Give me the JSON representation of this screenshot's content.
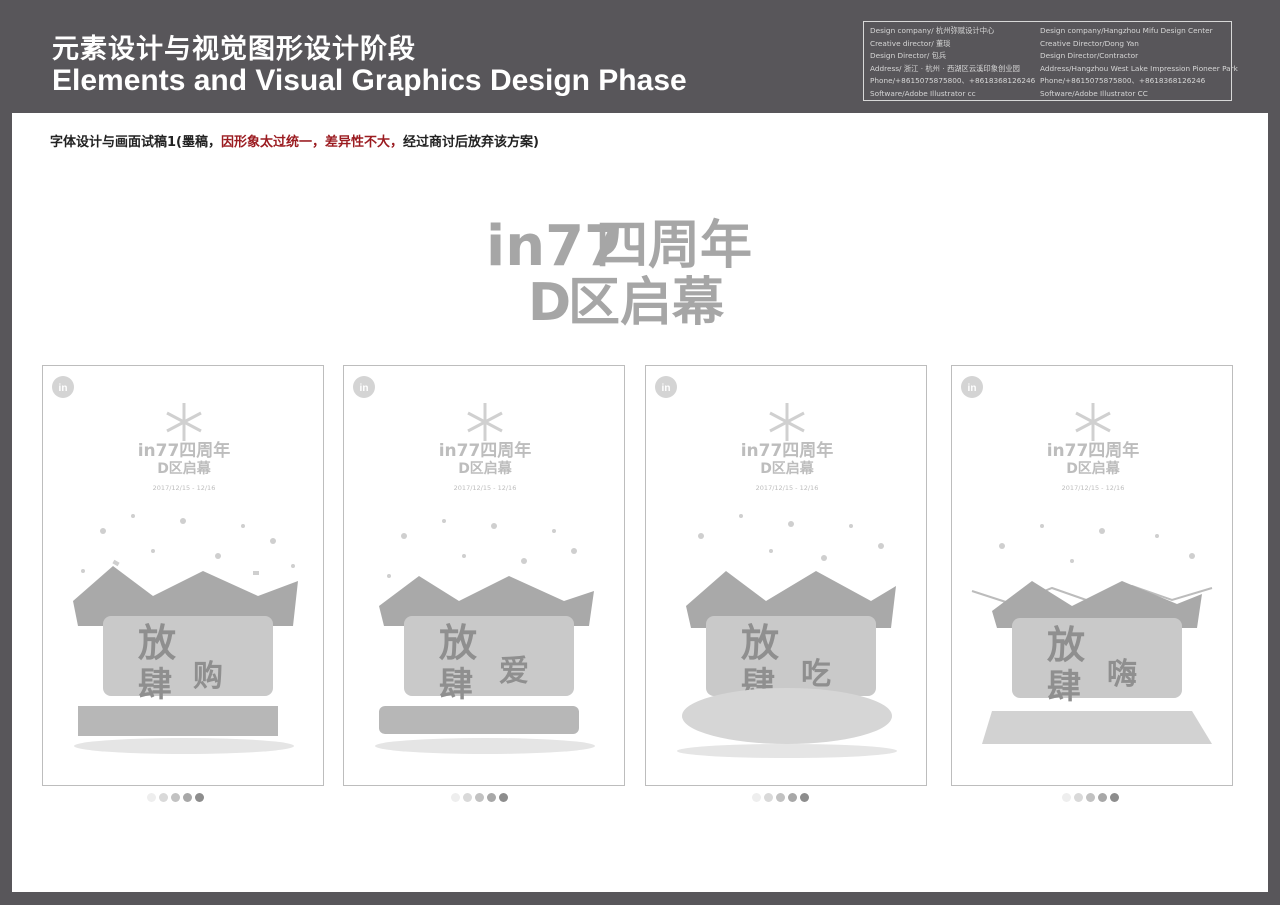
{
  "header": {
    "title_cn": "元素设计与视觉图形设计阶段",
    "title_en": "Elements and Visual Graphics Design Phase"
  },
  "info": {
    "left": [
      "Design company/ 杭州弥赋设计中心",
      "Creative director/ 董琰",
      "Design Director/ 包兵",
      "Address/ 浙江 · 杭州 · 西湖区云溪印象创业园",
      "Phone/+8615075875800、+8618368126246",
      "Software/Adobe Illustrator cc"
    ],
    "right": [
      "Design company/Hangzhou Mifu Design Center",
      "Creative Director/Dong Yan",
      "Design Director/Contractor",
      "Address/Hangzhou West Lake Impression Pioneer Park",
      "Phone/+8615075875800、+8618368126246",
      "Software/Adobe Illustrator CC"
    ]
  },
  "subtitle": {
    "part1": "字体设计与画面试稿1(墨稿，",
    "highlight1": "因形象太过统一，",
    "highlight2": "差异性不大，",
    "part2": "经过商讨后放弃该方案)"
  },
  "logo": {
    "line1_brand": "in77",
    "line1_text": "四周年",
    "line2_brand": "D",
    "line2_text": "区启幕"
  },
  "posters": [
    {
      "corner_logo": "in",
      "brand": "in77四周年",
      "sub": "D区启幕",
      "date": "2017/12/15 - 12/16",
      "word1": "放",
      "word2": "肆",
      "word3": "购"
    },
    {
      "corner_logo": "in",
      "brand": "in77四周年",
      "sub": "D区启幕",
      "date": "2017/12/15 - 12/16",
      "word1": "放",
      "word2": "肆",
      "word3": "爱"
    },
    {
      "corner_logo": "in",
      "brand": "in77四周年",
      "sub": "D区启幕",
      "date": "2017/12/15 - 12/16",
      "word1": "放",
      "word2": "肆",
      "word3": "吃"
    },
    {
      "corner_logo": "in",
      "brand": "in77四周年",
      "sub": "D区启幕",
      "date": "2017/12/15 - 12/16",
      "word1": "放",
      "word2": "肆",
      "word3": "嗨"
    }
  ],
  "palette": {
    "header_bg": "#58565a",
    "highlight_red": "#9b1c21",
    "swatches": [
      "#eeeeee",
      "#d9d9d9",
      "#c2c2c2",
      "#a8a8a8",
      "#8d8d8d"
    ]
  }
}
